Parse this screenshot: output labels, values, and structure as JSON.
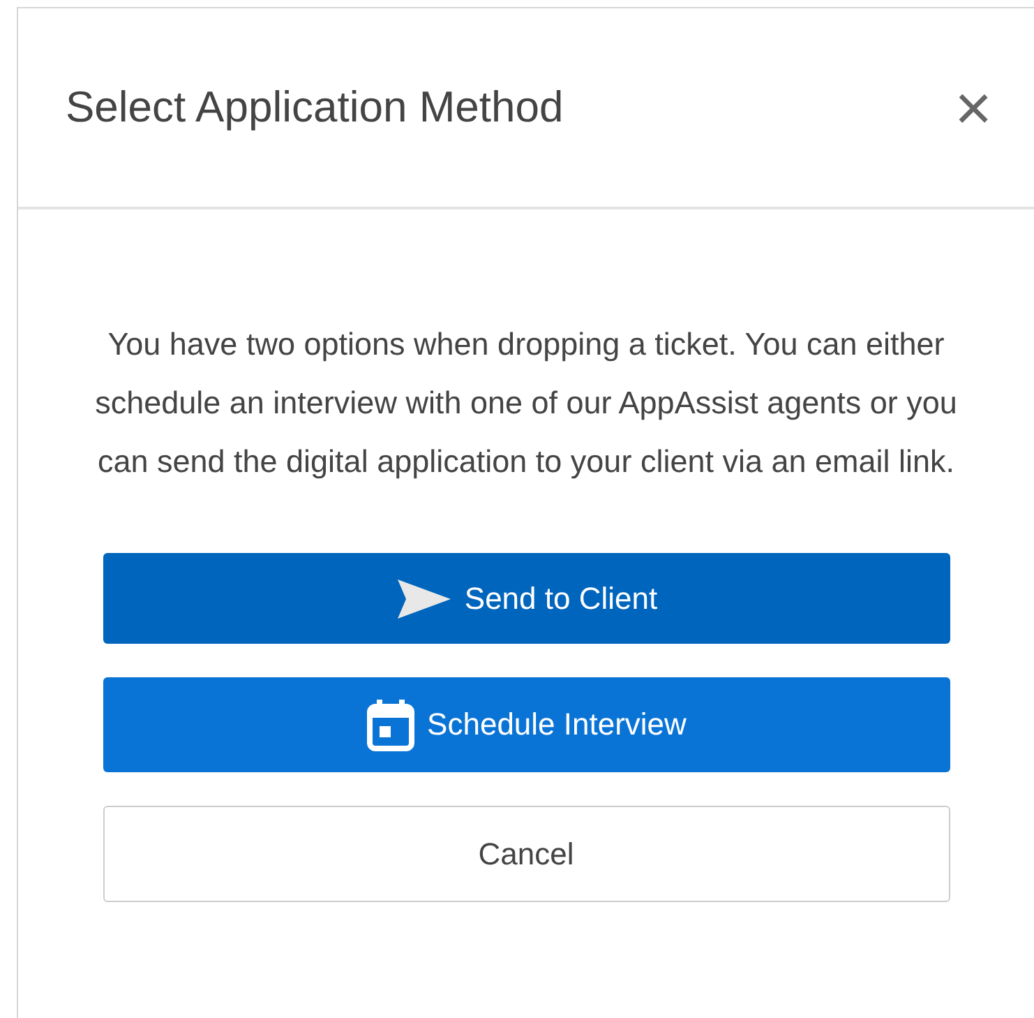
{
  "dialog": {
    "title": "Select Application Method",
    "close": "×"
  },
  "message": "You have two options when dropping a ticket. You can either schedule an interview with one of our AppAssist agents or you can send the digital application to your client via an email link.",
  "buttons": [
    {
      "label": "Send to Client",
      "kind": "send"
    },
    {
      "label": "Schedule Interview",
      "kind": "schedule"
    },
    {
      "label": "Cancel",
      "kind": "cancel"
    }
  ]
}
